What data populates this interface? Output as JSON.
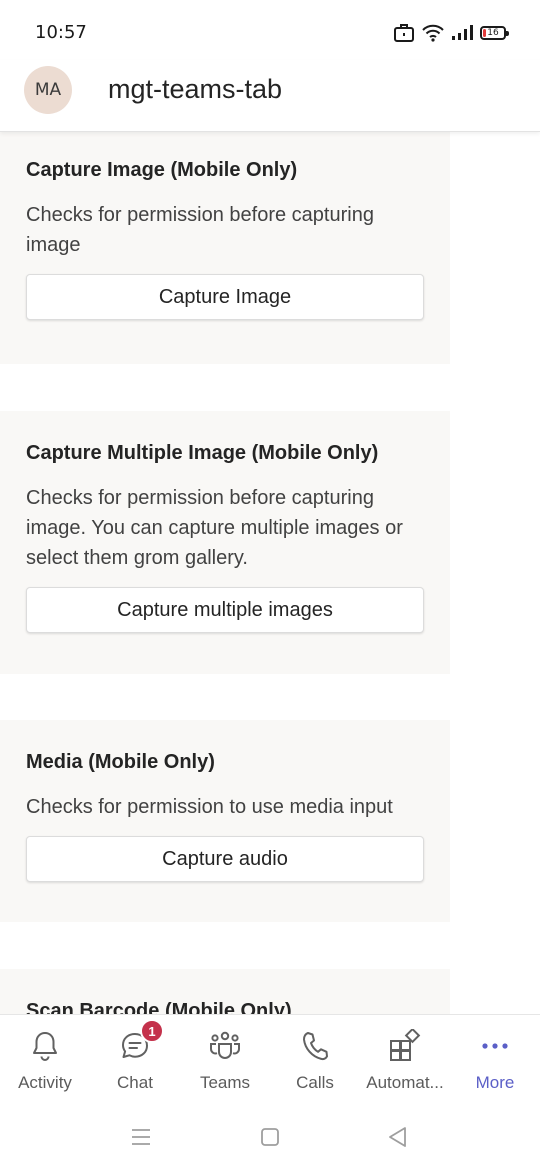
{
  "status_bar": {
    "time": "10:57",
    "battery_level": "16",
    "battery_color": "#e23b3b",
    "icons": [
      "briefcase-icon",
      "wifi-icon",
      "signal-icon",
      "battery-icon"
    ]
  },
  "header": {
    "avatar_initials": "MA",
    "title": "mgt-teams-tab"
  },
  "cards": [
    {
      "title": "Capture Image (Mobile Only)",
      "description": "Checks for permission before capturing image",
      "button_label": "Capture Image"
    },
    {
      "title": "Capture Multiple Image (Mobile Only)",
      "description": "Checks for permission before capturing image. You can capture multiple images or select them grom gallery.",
      "button_label": "Capture multiple images"
    },
    {
      "title": "Media (Mobile Only)",
      "description": "Checks for permission to use media input",
      "button_label": "Capture audio"
    },
    {
      "title": "Scan Barcode (Mobile Only)"
    }
  ],
  "bottom_nav": {
    "items": [
      {
        "label": "Activity",
        "icon": "bell-icon"
      },
      {
        "label": "Chat",
        "icon": "chat-icon",
        "badge": "1"
      },
      {
        "label": "Teams",
        "icon": "teams-icon"
      },
      {
        "label": "Calls",
        "icon": "phone-icon"
      },
      {
        "label": "Automat...",
        "icon": "apps-icon"
      },
      {
        "label": "More",
        "icon": "more-icon"
      }
    ],
    "accent_color": "#5b5fc7",
    "badge_color": "#c4314b"
  },
  "system_nav": {
    "icons": [
      "menu-icon",
      "home-icon",
      "back-icon"
    ]
  }
}
